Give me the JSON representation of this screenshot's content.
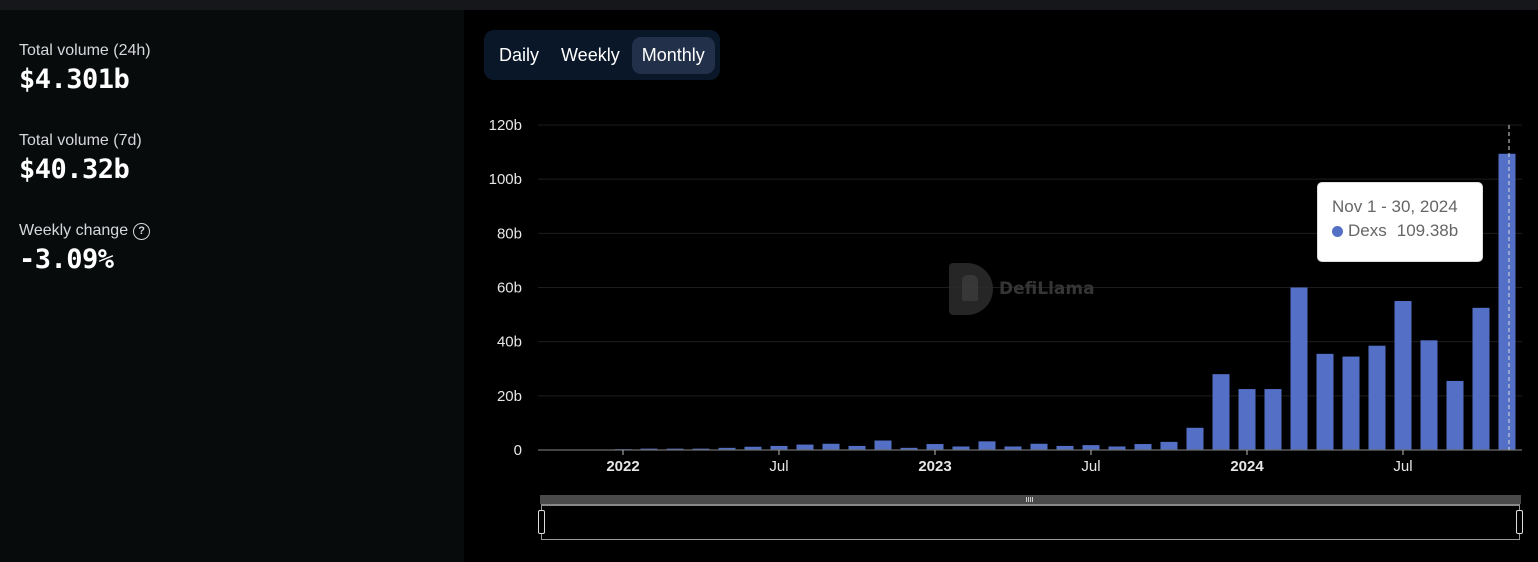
{
  "stats": [
    {
      "label": "Total volume (24h)",
      "value": "$4.301b",
      "has_help": false
    },
    {
      "label": "Total volume (7d)",
      "value": "$40.32b",
      "has_help": false
    },
    {
      "label": "Weekly change",
      "value": "-3.09%",
      "has_help": true
    }
  ],
  "help_icon_glyph": "?",
  "toggle": {
    "options": [
      "Daily",
      "Weekly",
      "Monthly"
    ],
    "selected": "Monthly"
  },
  "watermark": {
    "text": "DefiLlama"
  },
  "tooltip": {
    "title": "Nov 1 - 30, 2024",
    "series_name": "Dexs",
    "value": "109.38b"
  },
  "colors": {
    "bar": "#5470c6",
    "grid": "#1c1c1c",
    "axis": "#6e6e6e",
    "toggle_bg": "#0a1729",
    "toggle_active": "#22304a"
  },
  "chart_data": {
    "type": "bar",
    "title": "",
    "xlabel": "",
    "ylabel": "",
    "ylim": [
      0,
      120
    ],
    "yticks": [
      0,
      20,
      40,
      60,
      80,
      100,
      120
    ],
    "ytick_labels": [
      "0",
      "20b",
      "40b",
      "60b",
      "80b",
      "100b",
      "120b"
    ],
    "x_tick_labels": [
      {
        "label": "2022",
        "month_index": 0,
        "bold": true
      },
      {
        "label": "Jul",
        "month_index": 6,
        "bold": false
      },
      {
        "label": "2023",
        "month_index": 12,
        "bold": true
      },
      {
        "label": "Jul",
        "month_index": 18,
        "bold": false
      },
      {
        "label": "2024",
        "month_index": 24,
        "bold": true
      },
      {
        "label": "Jul",
        "month_index": 30,
        "bold": false
      }
    ],
    "grid": true,
    "legend": "none",
    "series": [
      {
        "name": "Dexs",
        "unit": "b",
        "categories": [
          "Jan 2022",
          "Feb 2022",
          "Mar 2022",
          "Apr 2022",
          "May 2022",
          "Jun 2022",
          "Jul 2022",
          "Aug 2022",
          "Sep 2022",
          "Oct 2022",
          "Nov 2022",
          "Dec 2022",
          "Jan 2023",
          "Feb 2023",
          "Mar 2023",
          "Apr 2023",
          "May 2023",
          "Jun 2023",
          "Jul 2023",
          "Aug 2023",
          "Sep 2023",
          "Oct 2023",
          "Nov 2023",
          "Dec 2023",
          "Jan 2024",
          "Feb 2024",
          "Mar 2024",
          "Apr 2024",
          "May 2024",
          "Jun 2024",
          "Jul 2024",
          "Aug 2024",
          "Sep 2024",
          "Oct 2024",
          "Nov 2024"
        ],
        "values": [
          0.3,
          0.5,
          0.5,
          0.5,
          0.8,
          1.2,
          1.5,
          2.0,
          2.3,
          1.5,
          3.5,
          0.8,
          2.2,
          1.3,
          3.2,
          1.3,
          2.3,
          1.5,
          1.8,
          1.3,
          2.2,
          3.0,
          8.2,
          28.0,
          22.5,
          22.5,
          60.0,
          35.5,
          34.5,
          38.5,
          55.0,
          40.5,
          25.5,
          52.5,
          109.38
        ]
      }
    ],
    "highlighted_index": 34
  }
}
